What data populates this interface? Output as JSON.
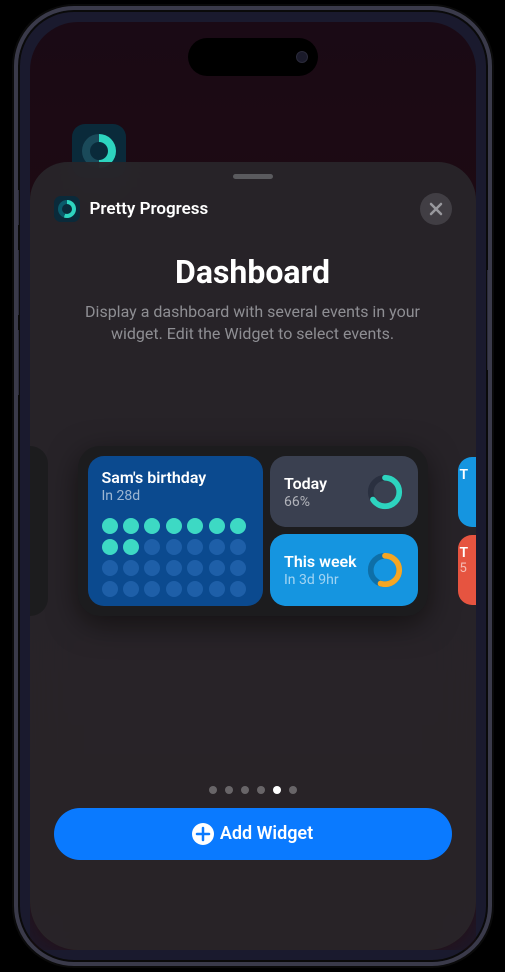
{
  "app": {
    "name": "Pretty Progress"
  },
  "page": {
    "title": "Dashboard",
    "subtitle": "Display a dashboard with several events in your widget. Edit the Widget to select events."
  },
  "widget": {
    "card1": {
      "title": "Sam's birthday",
      "sub": "In 28d",
      "filled_dots": 9,
      "total_dots": 28
    },
    "card2": {
      "title": "Today",
      "sub": "66%",
      "progress": 66,
      "ring_color": "#2dd4bf",
      "ring_track": "#2a3040"
    },
    "card3": {
      "title": "This week",
      "sub": "In 3d 9hr",
      "progress": 55,
      "ring_color": "#f5a623",
      "ring_track": "#0e6fa8"
    }
  },
  "peek": {
    "blue": {
      "t": "T"
    },
    "red": {
      "t": "T",
      "s": "5"
    }
  },
  "pagination": {
    "total": 6,
    "active": 4
  },
  "buttons": {
    "add": "Add Widget"
  }
}
